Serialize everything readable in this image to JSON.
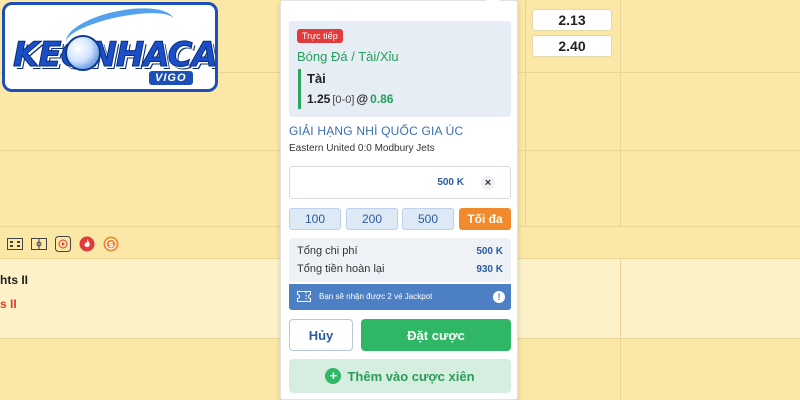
{
  "logo": {
    "brand": "KEONHACAI",
    "subtext": "VIGO"
  },
  "background": {
    "odds": [
      "2.13",
      "2.40"
    ],
    "team_home_partial": "hts II",
    "team_away_partial": "s II",
    "icons": [
      "scoreboard-icon",
      "field-icon",
      "play-icon",
      "fire-icon",
      "coin-icon"
    ]
  },
  "slip": {
    "live_badge": "Trực tiếp",
    "market": "Bóng Đá / Tài/Xỉu",
    "pick": "Tài",
    "handicap": "1.25",
    "score": "[0-0]",
    "at": "@",
    "odds": "0.86",
    "league": "GIẢI HẠNG NHÌ QUỐC GIA ÚC",
    "match": "Eastern United 0:0 Modbury Jets",
    "stake": "500 K",
    "clear": "×",
    "quick_amounts": [
      "100",
      "200",
      "500"
    ],
    "max_label": "Tối đa",
    "total_cost_label": "Tổng chi phí",
    "total_cost_value": "500 K",
    "total_return_label": "Tổng tiền hoàn lại",
    "total_return_value": "930 K",
    "jackpot_text": "Bạn sẽ nhận được 2 vé Jackpot",
    "jackpot_info": "!",
    "cancel_label": "Hủy",
    "place_label": "Đặt cược",
    "parlay_plus": "+",
    "parlay_label": "Thêm vào cược xiên"
  },
  "colors": {
    "accent_green": "#2fb765",
    "accent_blue": "#2c5aa0",
    "orange": "#f08a2c",
    "live_red": "#e23b3b",
    "background": "#fbe8a6"
  }
}
